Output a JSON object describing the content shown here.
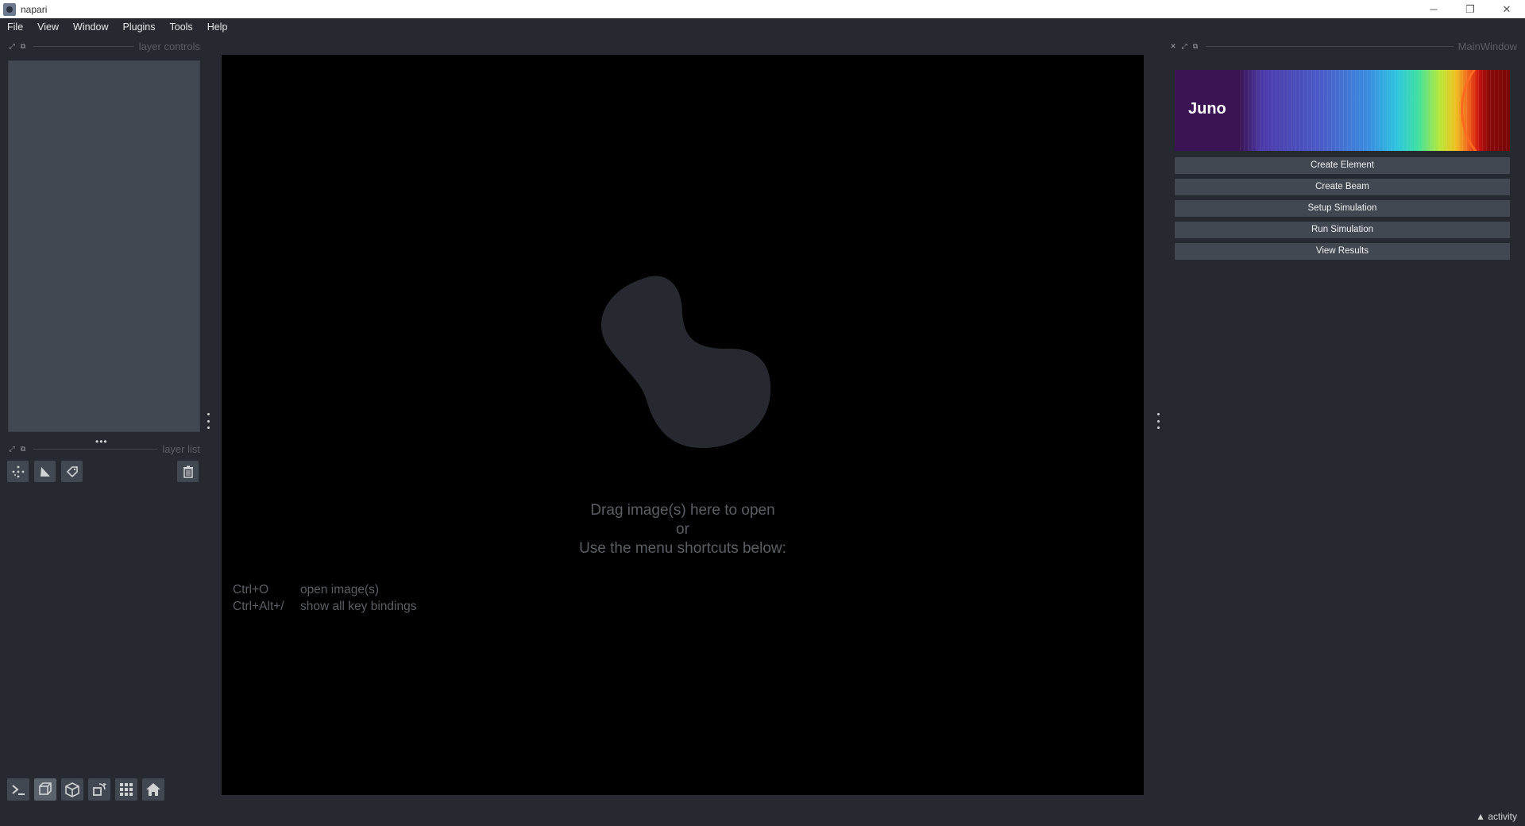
{
  "window": {
    "title": "napari",
    "controls": [
      "─",
      "❐",
      "✕"
    ]
  },
  "menu": [
    "File",
    "View",
    "Window",
    "Plugins",
    "Tools",
    "Help"
  ],
  "docks": {
    "layer_controls": {
      "title": "layer controls"
    },
    "layer_list": {
      "title": "layer list"
    },
    "main_window": {
      "title": "MainWindow"
    }
  },
  "welcome": {
    "line1": "Drag image(s) here to open",
    "line2": "or",
    "line3": "Use the menu shortcuts below:",
    "shortcuts": [
      {
        "key": "Ctrl+O",
        "action": "open image(s)"
      },
      {
        "key": "Ctrl+Alt+/",
        "action": "show all key bindings"
      }
    ]
  },
  "plugin": {
    "banner_title": "Juno",
    "buttons": [
      "Create Element",
      "Create Beam",
      "Setup Simulation",
      "Run Simulation",
      "View Results"
    ]
  },
  "layer_buttons": [
    "new-points-layer-icon",
    "new-shapes-layer-icon",
    "new-labels-layer-icon",
    "delete-layer-icon"
  ],
  "viewer_buttons": [
    "console-icon",
    "ndisplay-icon",
    "roll-axes-icon",
    "transpose-icon",
    "grid-icon",
    "home-icon"
  ],
  "status": {
    "activity": "activity"
  },
  "colors": {
    "background": "#262930",
    "panel": "#414851",
    "canvas": "#000000",
    "text_dim": "#5a5f66"
  }
}
